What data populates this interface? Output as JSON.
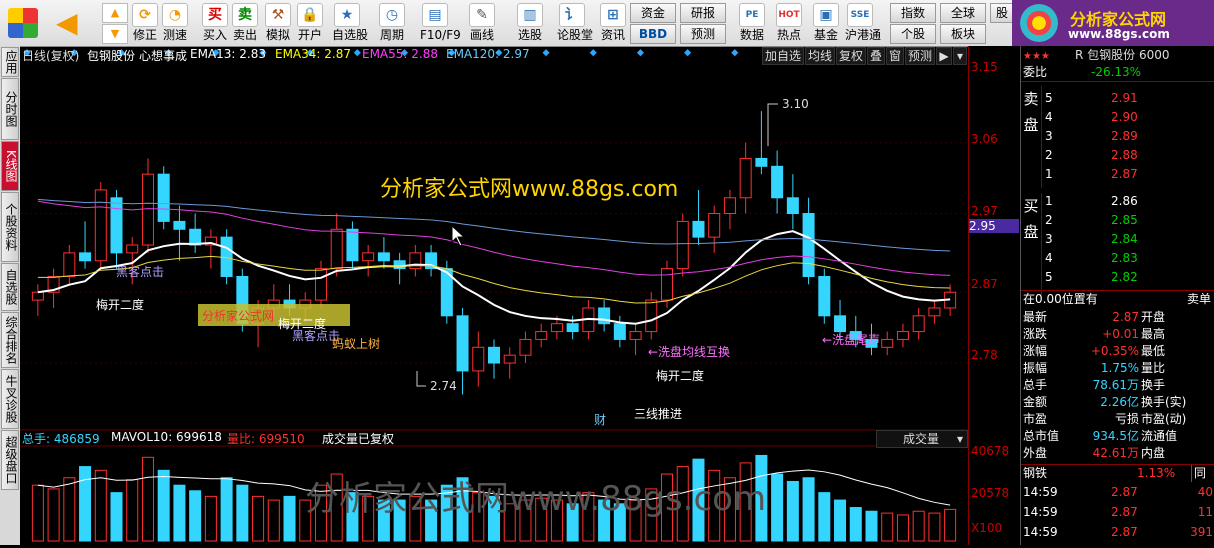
{
  "toolbar": {
    "buttons": [
      {
        "label": "修正",
        "icon": "refresh-icon"
      },
      {
        "label": "测速",
        "icon": "clock-icon"
      },
      {
        "label": "买入",
        "icon": "buy-icon",
        "glyph": "买"
      },
      {
        "label": "卖出",
        "icon": "sell-icon",
        "glyph": "卖"
      },
      {
        "label": "模拟",
        "icon": "hammer-icon"
      },
      {
        "label": "开户",
        "icon": "lock-icon"
      },
      {
        "label": "自选股",
        "icon": "star-icon"
      },
      {
        "label": "周期",
        "icon": "cycle-icon"
      },
      {
        "label": "F10/F9",
        "icon": "f10-icon"
      },
      {
        "label": "画线",
        "icon": "pen-icon"
      },
      {
        "label": "选股",
        "icon": "screen-icon"
      },
      {
        "label": "论股堂",
        "icon": "forum-icon"
      },
      {
        "label": "资讯",
        "icon": "news-icon"
      },
      {
        "label": "数据",
        "icon": "pe-icon",
        "glyph": "PE"
      },
      {
        "label": "热点",
        "icon": "hot-icon",
        "glyph": "HOT"
      },
      {
        "label": "基金",
        "icon": "fund-icon"
      },
      {
        "label": "沪港通",
        "icon": "hk-icon",
        "glyph": "SSE"
      }
    ],
    "boxes": {
      "b1": "资金",
      "b2": "BBD",
      "b3": "研报",
      "b4": "预测",
      "b5": "指数",
      "b6": "个股",
      "b7": "全球",
      "b8": "板块",
      "b9": "股"
    }
  },
  "logo": {
    "name": "分析家公式网",
    "url": "www.88gs.com"
  },
  "side_tabs": [
    "应用",
    "分时图",
    "K线图",
    "个股资料",
    "自选股",
    "综合排名",
    "牛叉诊股",
    "超级盘口"
  ],
  "indicators": {
    "title": "日线(复权)",
    "stock": "包钢股份",
    "formula": "心想事成",
    "ema13": "EMA13: 2.83",
    "ema34": "EMA34: 2.87",
    "ema55": "EMA55: 2.88",
    "ema120": "EMA120: 2.97"
  },
  "top_buttons": [
    "加自选",
    "均线",
    "复权",
    "叠",
    "窗",
    "预测"
  ],
  "volume_ind": {
    "total": "总手: 486859",
    "mavol": "MAVOL10: 699618",
    "lb": "量比: 699510",
    "note": "成交量已复权",
    "dropdown": "成交量"
  },
  "annotations": {
    "watermark": "分析家公式网www.88gs.com",
    "watermark2": "分析家公式网",
    "watermark3": "分析家公式网www.88gs.com",
    "a1": "梅开二度",
    "a2": "黑客点击",
    "a3": "黑客点击",
    "a4": "蚂蚁上树",
    "a5": "梅开二度",
    "a6": "←洗盘均线互换",
    "a7": "←洗盘尾声",
    "a8": "梅开二度",
    "a9": "三线推进",
    "a10": "财",
    "high": "3.10",
    "low": "2.74",
    "a11": "梅开二度",
    "a12": "黑客点击"
  },
  "price_axis": [
    "3.15",
    "3.06",
    "2.97",
    "2.95",
    "2.87",
    "2.78"
  ],
  "vol_axis": [
    "40678",
    "20578",
    "X100"
  ],
  "right_panel": {
    "stars": "★★★",
    "header": "R 包钢股份 6000",
    "webi": {
      "label": "委比",
      "value": "-26.13%"
    },
    "sell_label": "卖盘",
    "sell": [
      {
        "n": "5",
        "p": "2.91"
      },
      {
        "n": "4",
        "p": "2.90"
      },
      {
        "n": "3",
        "p": "2.89"
      },
      {
        "n": "2",
        "p": "2.88"
      },
      {
        "n": "1",
        "p": "2.87"
      }
    ],
    "buy_label": "买盘",
    "buy": [
      {
        "n": "1",
        "p": "2.86"
      },
      {
        "n": "2",
        "p": "2.85"
      },
      {
        "n": "3",
        "p": "2.84"
      },
      {
        "n": "4",
        "p": "2.83"
      },
      {
        "n": "5",
        "p": "2.82"
      }
    ],
    "pos": "在0.00位置有",
    "sell_single": "卖单",
    "stats": [
      {
        "k": "最新",
        "v": "2.87",
        "k2": "开盘"
      },
      {
        "k": "涨跌",
        "v": "+0.01",
        "k2": "最高"
      },
      {
        "k": "涨幅",
        "v": "+0.35%",
        "k2": "最低"
      },
      {
        "k": "振幅",
        "v": "1.75%",
        "k2": "量比"
      },
      {
        "k": "总手",
        "v": "78.61万",
        "k2": "换手"
      },
      {
        "k": "金额",
        "v": "2.26亿",
        "k2": "换手(实)"
      },
      {
        "k": "市盈",
        "v": "亏损",
        "k2": "市盈(动)"
      },
      {
        "k": "总市值",
        "v": "934.5亿",
        "k2": "流通值"
      },
      {
        "k": "外盘",
        "v": "42.61万",
        "k2": "内盘"
      }
    ],
    "sector": {
      "name": "钢铁",
      "chg": "1.13%",
      "extra": "同"
    },
    "ticks": [
      {
        "t": "14:59",
        "p": "2.87",
        "v": "40"
      },
      {
        "t": "14:59",
        "p": "2.87",
        "v": "11"
      },
      {
        "t": "14:59",
        "p": "2.87",
        "v": "391"
      }
    ]
  },
  "chart_data": {
    "type": "candlestick",
    "ylim": [
      2.7,
      3.16
    ],
    "candles": [
      [
        2.86,
        2.88,
        2.84,
        2.87
      ],
      [
        2.87,
        2.9,
        2.85,
        2.89
      ],
      [
        2.89,
        2.93,
        2.88,
        2.92
      ],
      [
        2.92,
        2.96,
        2.9,
        2.91
      ],
      [
        2.91,
        3.01,
        2.9,
        3.0
      ],
      [
        2.99,
        3.0,
        2.9,
        2.92
      ],
      [
        2.92,
        2.94,
        2.88,
        2.93
      ],
      [
        2.93,
        3.04,
        2.92,
        3.02
      ],
      [
        3.02,
        3.03,
        2.95,
        2.96
      ],
      [
        2.96,
        2.98,
        2.91,
        2.95
      ],
      [
        2.95,
        2.97,
        2.92,
        2.93
      ],
      [
        2.93,
        2.95,
        2.9,
        2.94
      ],
      [
        2.94,
        2.95,
        2.88,
        2.89
      ],
      [
        2.89,
        2.9,
        2.82,
        2.83
      ],
      [
        2.83,
        2.86,
        2.8,
        2.85
      ],
      [
        2.85,
        2.88,
        2.84,
        2.86
      ],
      [
        2.86,
        2.88,
        2.84,
        2.85
      ],
      [
        2.85,
        2.87,
        2.83,
        2.86
      ],
      [
        2.86,
        2.91,
        2.85,
        2.9
      ],
      [
        2.9,
        2.97,
        2.89,
        2.95
      ],
      [
        2.95,
        2.96,
        2.9,
        2.91
      ],
      [
        2.91,
        2.93,
        2.89,
        2.92
      ],
      [
        2.92,
        2.94,
        2.9,
        2.91
      ],
      [
        2.91,
        2.92,
        2.88,
        2.9
      ],
      [
        2.9,
        2.93,
        2.89,
        2.92
      ],
      [
        2.92,
        2.93,
        2.89,
        2.9
      ],
      [
        2.9,
        2.91,
        2.83,
        2.84
      ],
      [
        2.84,
        2.85,
        2.74,
        2.77
      ],
      [
        2.77,
        2.82,
        2.75,
        2.8
      ],
      [
        2.8,
        2.81,
        2.76,
        2.78
      ],
      [
        2.78,
        2.8,
        2.76,
        2.79
      ],
      [
        2.79,
        2.82,
        2.78,
        2.81
      ],
      [
        2.81,
        2.83,
        2.8,
        2.82
      ],
      [
        2.82,
        2.84,
        2.81,
        2.83
      ],
      [
        2.83,
        2.84,
        2.81,
        2.82
      ],
      [
        2.82,
        2.86,
        2.81,
        2.85
      ],
      [
        2.85,
        2.86,
        2.82,
        2.83
      ],
      [
        2.83,
        2.84,
        2.8,
        2.81
      ],
      [
        2.81,
        2.83,
        2.79,
        2.82
      ],
      [
        2.82,
        2.87,
        2.81,
        2.86
      ],
      [
        2.86,
        2.91,
        2.85,
        2.9
      ],
      [
        2.9,
        2.97,
        2.89,
        2.96
      ],
      [
        2.96,
        3.0,
        2.93,
        2.94
      ],
      [
        2.94,
        2.98,
        2.92,
        2.97
      ],
      [
        2.97,
        3.0,
        2.95,
        2.99
      ],
      [
        2.99,
        3.06,
        2.97,
        3.04
      ],
      [
        3.04,
        3.1,
        3.02,
        3.03
      ],
      [
        3.03,
        3.05,
        2.97,
        2.99
      ],
      [
        2.99,
        3.02,
        2.95,
        2.97
      ],
      [
        2.97,
        2.99,
        2.88,
        2.89
      ],
      [
        2.89,
        2.9,
        2.83,
        2.84
      ],
      [
        2.84,
        2.86,
        2.81,
        2.82
      ],
      [
        2.82,
        2.84,
        2.8,
        2.81
      ],
      [
        2.81,
        2.83,
        2.79,
        2.8
      ],
      [
        2.8,
        2.82,
        2.79,
        2.81
      ],
      [
        2.81,
        2.83,
        2.8,
        2.82
      ],
      [
        2.82,
        2.85,
        2.81,
        2.84
      ],
      [
        2.84,
        2.86,
        2.83,
        2.85
      ],
      [
        2.85,
        2.88,
        2.84,
        2.87
      ]
    ],
    "volumes": [
      30,
      28,
      34,
      40,
      38,
      26,
      33,
      45,
      38,
      30,
      27,
      24,
      34,
      30,
      24,
      22,
      24,
      22,
      30,
      36,
      26,
      24,
      22,
      22,
      24,
      22,
      30,
      34,
      26,
      24,
      20,
      22,
      23,
      22,
      20,
      26,
      22,
      20,
      22,
      28,
      36,
      40,
      44,
      38,
      34,
      42,
      46,
      36,
      32,
      34,
      26,
      22,
      18,
      16,
      15,
      14,
      16,
      15,
      17
    ]
  }
}
